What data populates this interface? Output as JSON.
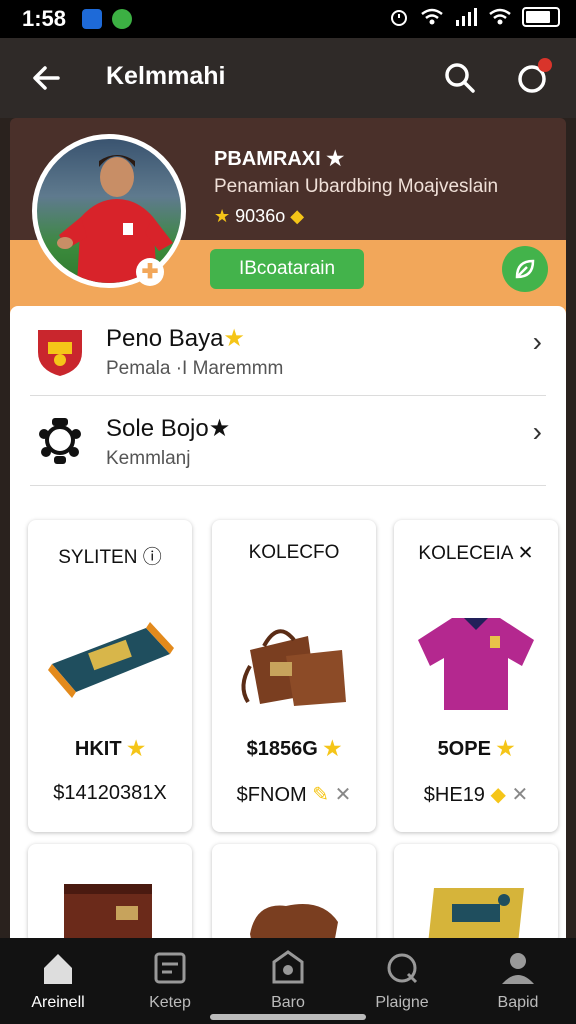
{
  "status_bar": {
    "time": "1:58"
  },
  "app_bar": {
    "title": "Kelmmahi"
  },
  "profile": {
    "name": "PBAMRAXI",
    "subtitle": "Penamian Ubardbing Moajveslain",
    "rating": "9036o",
    "primary_button": "IBcoatarain"
  },
  "list": [
    {
      "title": "Peno Baya",
      "subtitle": "Pemala  ·I  Maremmm"
    },
    {
      "title": "Sole Bojo",
      "subtitle": "Kemmlanj"
    }
  ],
  "products": [
    {
      "title": "SYLITEN",
      "price": "HKIT",
      "code": "$14120381X"
    },
    {
      "title": "KOLECFO",
      "price": "$1856G",
      "code": "$FNOM"
    },
    {
      "title": "KOLECEIA",
      "price": "5OPE",
      "code": "$HE19"
    }
  ],
  "bottom_nav": [
    {
      "label": "Areinell"
    },
    {
      "label": "Ketep"
    },
    {
      "label": "Baro"
    },
    {
      "label": "Plaigne"
    },
    {
      "label": "Bapid"
    }
  ],
  "colors": {
    "accent_green": "#43b34b",
    "header_brown": "#4a302a",
    "header_orange": "#f2a75a",
    "star_gold": "#f5c518"
  }
}
